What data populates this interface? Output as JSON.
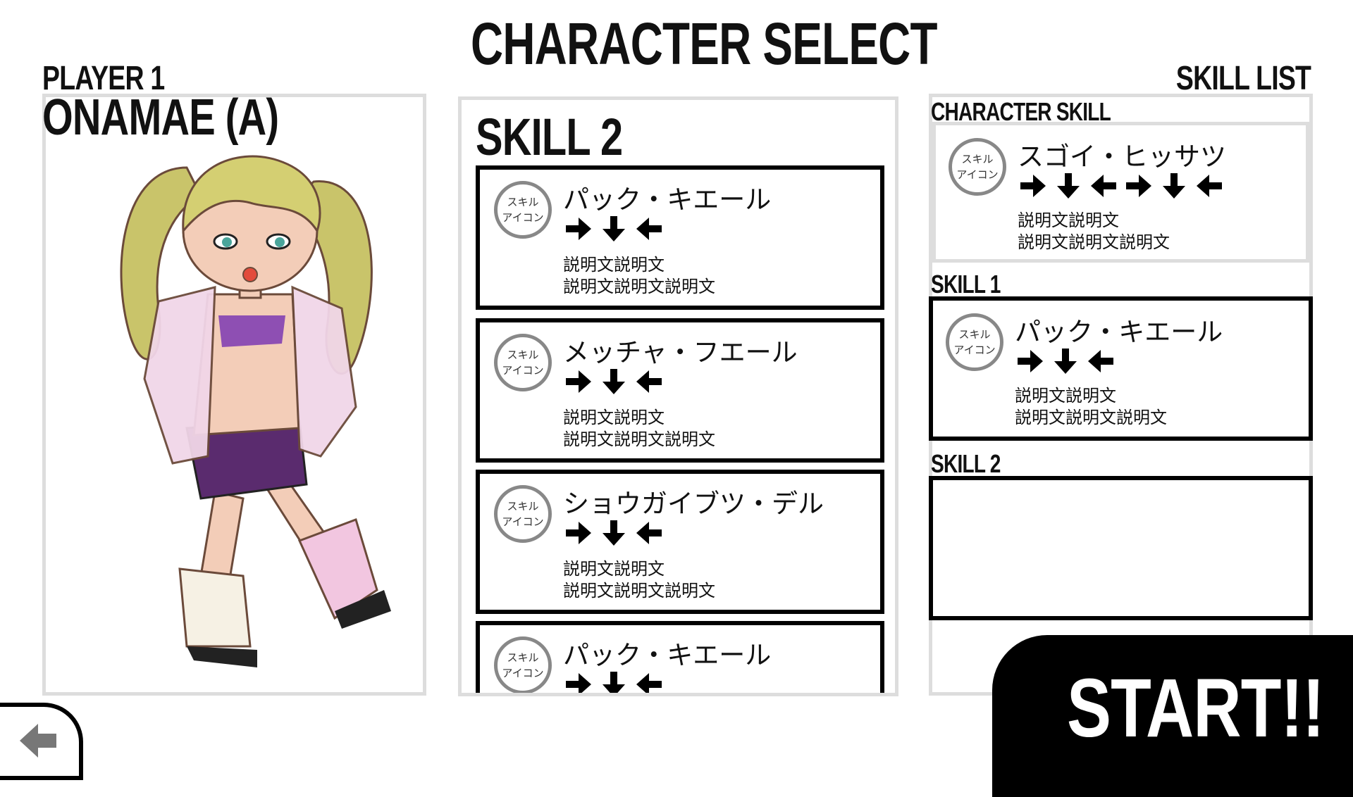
{
  "header": {
    "title": "CHARACTER SELECT"
  },
  "player": {
    "label": "PLAYER 1",
    "character_name": "ONAMAE (A)"
  },
  "middle": {
    "heading": "SKILL 2",
    "skills": [
      {
        "icon_label_1": "スキル",
        "icon_label_2": "アイコン",
        "name": "パック・キエール",
        "command": [
          "right",
          "down",
          "left"
        ],
        "desc_1": "説明文説明文",
        "desc_2": "説明文説明文説明文"
      },
      {
        "icon_label_1": "スキル",
        "icon_label_2": "アイコン",
        "name": "メッチャ・フエール",
        "command": [
          "right",
          "down",
          "left"
        ],
        "desc_1": "説明文説明文",
        "desc_2": "説明文説明文説明文"
      },
      {
        "icon_label_1": "スキル",
        "icon_label_2": "アイコン",
        "name": "ショウガイブツ・デル",
        "command": [
          "right",
          "down",
          "left"
        ],
        "desc_1": "説明文説明文",
        "desc_2": "説明文説明文説明文"
      },
      {
        "icon_label_1": "スキル",
        "icon_label_2": "アイコン",
        "name": "パック・キエール",
        "command": [
          "right",
          "down",
          "left"
        ],
        "desc_1": "",
        "desc_2": ""
      }
    ]
  },
  "skill_list": {
    "title": "SKILL LIST",
    "character_skill": {
      "label": "CHARACTER SKILL",
      "icon_label_1": "スキル",
      "icon_label_2": "アイコン",
      "name": "スゴイ・ヒッサツ",
      "command": [
        "right",
        "down",
        "left",
        "right",
        "down",
        "left"
      ],
      "desc_1": "説明文説明文",
      "desc_2": "説明文説明文説明文"
    },
    "skill_1": {
      "label": "SKILL 1",
      "icon_label_1": "スキル",
      "icon_label_2": "アイコン",
      "name": "パック・キエール",
      "command": [
        "right",
        "down",
        "left"
      ],
      "desc_1": "説明文説明文",
      "desc_2": "説明文説明文説明文"
    },
    "skill_2": {
      "label": "SKILL 2"
    }
  },
  "actions": {
    "start_label": "START!!",
    "back_icon": "arrow-left-icon"
  },
  "colors": {
    "ink": "#000000",
    "panel_border": "#dddddd",
    "icon_ring": "#888888",
    "background": "#ffffff"
  }
}
